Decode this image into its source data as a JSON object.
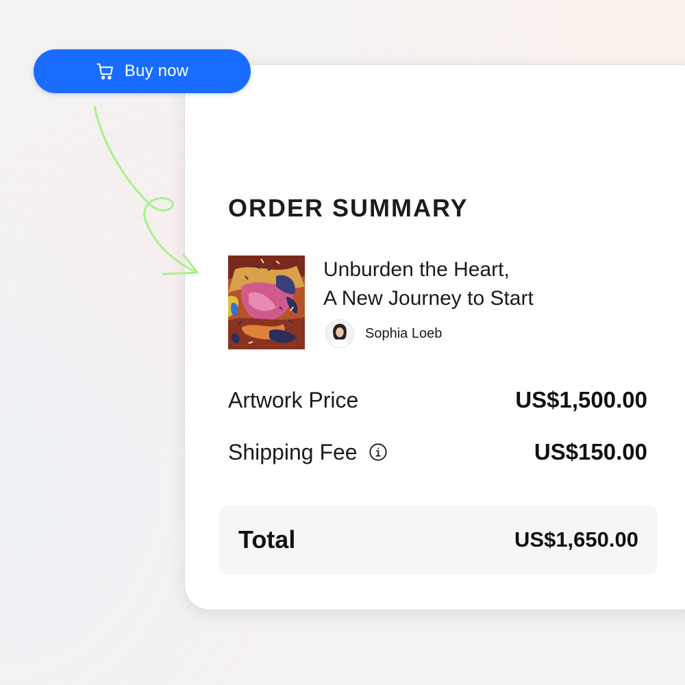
{
  "buy_button": {
    "label": "Buy now",
    "icon": "cart-icon",
    "color": "#1a6cff"
  },
  "annotation": {
    "icon": "hand-drawn-arrow-icon",
    "color": "#a8f08a"
  },
  "order": {
    "title": "ORDER SUMMARY",
    "artwork": {
      "title_line1": "Unburden the Heart,",
      "title_line2": "A New Journey to Start",
      "artist": "Sophia Loeb"
    },
    "artwork_price_label": "Artwork Price",
    "artwork_price": "US$1,500.00",
    "shipping_label": "Shipping Fee",
    "shipping_icon": "info-icon",
    "shipping_fee": "US$150.00",
    "total_label": "Total",
    "total_value": "US$1,650.00"
  }
}
